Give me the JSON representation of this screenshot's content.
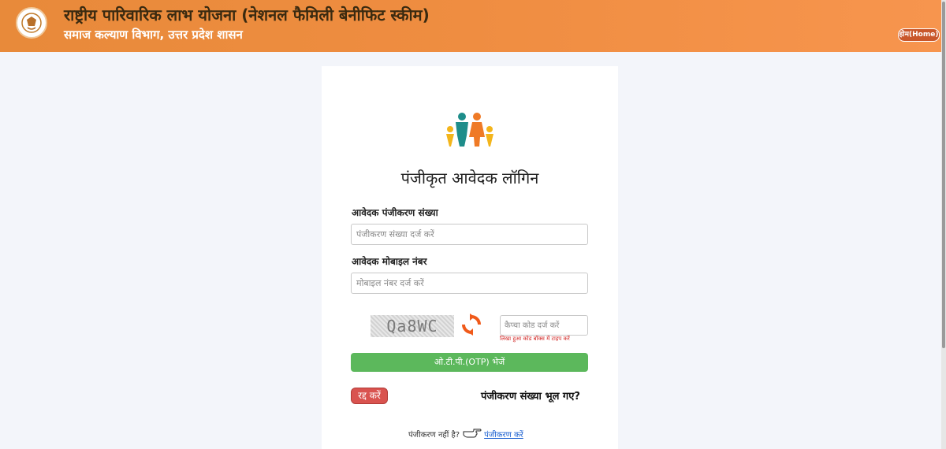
{
  "header": {
    "title": "राष्ट्रीय पारिवारिक लाभ योजना (नेशनल फैमिली बेनीफिट स्कीम)",
    "subtitle": "समाज कल्याण विभाग, उत्तर प्रदेश शासन",
    "home_label": "होम(Home)",
    "emblem_icon": "up-government-emblem-icon"
  },
  "login": {
    "family_icon": "family-icon",
    "title": "पंजीकृत आवेदक लॉगिन",
    "reg_label": "आवेदक पंजीकरण संख्या",
    "reg_placeholder": "पंजीकरण संख्या दर्ज करें",
    "mobile_label": "आवेदक मोबाइल नंबर",
    "mobile_placeholder": "मोबाइल नंबर दर्ज करें",
    "captcha_text": "Qa8WC",
    "refresh_icon": "refresh-icon",
    "captcha_placeholder": "कैप्चा कोड दर्ज करें",
    "captcha_hint": "लिखा हुआ कोड बॉक्स में टाइप करें",
    "otp_button": "ओ.टी.पी.(OTP) भेजें",
    "cancel_button": "रद्द करें",
    "forgot_link": "पंजीकरण संख्या भूल गए?",
    "not_registered": "पंजीकरण नहीं है?",
    "hand_icon": "pointing-hand-icon",
    "register_link": "पंजीकरण करें"
  },
  "colors": {
    "header_orange": "#ef8d41",
    "otp_green": "#5cb85c",
    "cancel_red": "#d9534f",
    "hint_red": "#d0211f",
    "link_blue": "#1a5fd0"
  }
}
